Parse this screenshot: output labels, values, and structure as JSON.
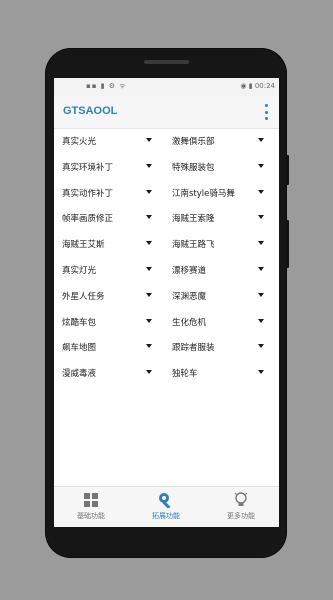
{
  "status_bar": {
    "left_icons": "▪▪ ▮ ⚙ ᯤ",
    "right_text": "◉ ▮ 00:24"
  },
  "app_bar": {
    "title": "GTSAOOL"
  },
  "features": [
    [
      "真实火光",
      "激舞俱乐部"
    ],
    [
      "真实环境补丁",
      "特殊服装包"
    ],
    [
      "真实动作补丁",
      "江南style骑马舞"
    ],
    [
      "帧率画质修正",
      "海贼王索隆"
    ],
    [
      "海贼王艾斯",
      "海贼王路飞"
    ],
    [
      "真实灯光",
      "漂移赛道"
    ],
    [
      "外星人任务",
      "深渊恶魔"
    ],
    [
      "炫酷车包",
      "生化危机"
    ],
    [
      "飙车地图",
      "跟踪者服装"
    ],
    [
      "漫威毒液",
      "独轮车"
    ]
  ],
  "bottom_nav": {
    "tabs": [
      {
        "label": "基础功能",
        "icon": "grid-icon",
        "active": false
      },
      {
        "label": "拓展功能",
        "icon": "wrench-icon",
        "active": true
      },
      {
        "label": "更多功能",
        "icon": "bulb-icon",
        "active": false
      }
    ]
  },
  "colors": {
    "accent": "#2f80b8",
    "device": "#161616",
    "background": "#9b9b9b"
  }
}
